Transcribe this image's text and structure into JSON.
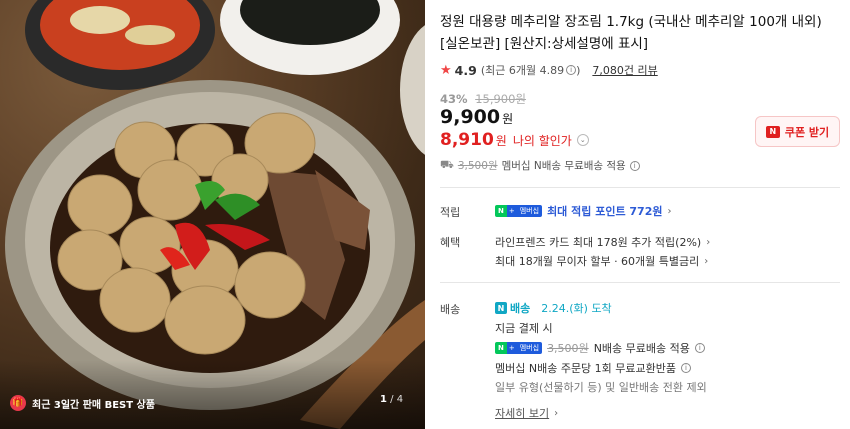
{
  "image": {
    "badge_text": "최근 3일간 판매 BEST 상품",
    "pager_current": "1",
    "pager_total": " / 4"
  },
  "product": {
    "title": "정원 대용량 메추리알 장조림 1.7kg (국내산 메추리알 100개 내외) [실온보관] [원산지:상세설명에 표시]",
    "rating": "4.9",
    "recent_rating": "(최근 6개월 4.89",
    "recent_rating_close": ")",
    "review_count": "7,080건 리뷰",
    "discount_rate": "43%",
    "original_price": "15,900원",
    "price": "9,900",
    "price_unit": "원",
    "my_price": "8,910",
    "my_price_unit": "원",
    "my_price_label": "나의 할인가",
    "coupon_label": "쿠폰 받기"
  },
  "shipping_summary": {
    "old_fee": "3,500원",
    "text": "멤버십 N배송 무료배송 적용"
  },
  "points": {
    "label": "적립",
    "text": "최대 적립 포인트 772원"
  },
  "benefits": {
    "label": "혜택",
    "line1": "라인프렌즈 카드 최대 178원 추가 적립(2%)",
    "line2": "최대 18개월 무이자 할부 · 60개월 특별금리"
  },
  "delivery": {
    "label": "배송",
    "badge": "배송",
    "arrival": "2.24.(화) 도착",
    "pay_now": "지금 결제 시",
    "old_fee": "3,500원",
    "free_text": "N배송 무료배송 적용",
    "exchange": "멤버십 N배송 주문당 1회 무료교환반품",
    "note": "일부 유형(선물하기 등) 및 일반배송 전환 제외",
    "detail_link": "자세히 보기"
  },
  "npay_badge": {
    "n": "N",
    "plus": "+",
    "membership": "멤버십"
  },
  "colors": {
    "accent_red": "#e02020",
    "naver_green": "#03c75a",
    "link_blue": "#2d5bd6",
    "delivery_teal": "#10a7c4"
  }
}
